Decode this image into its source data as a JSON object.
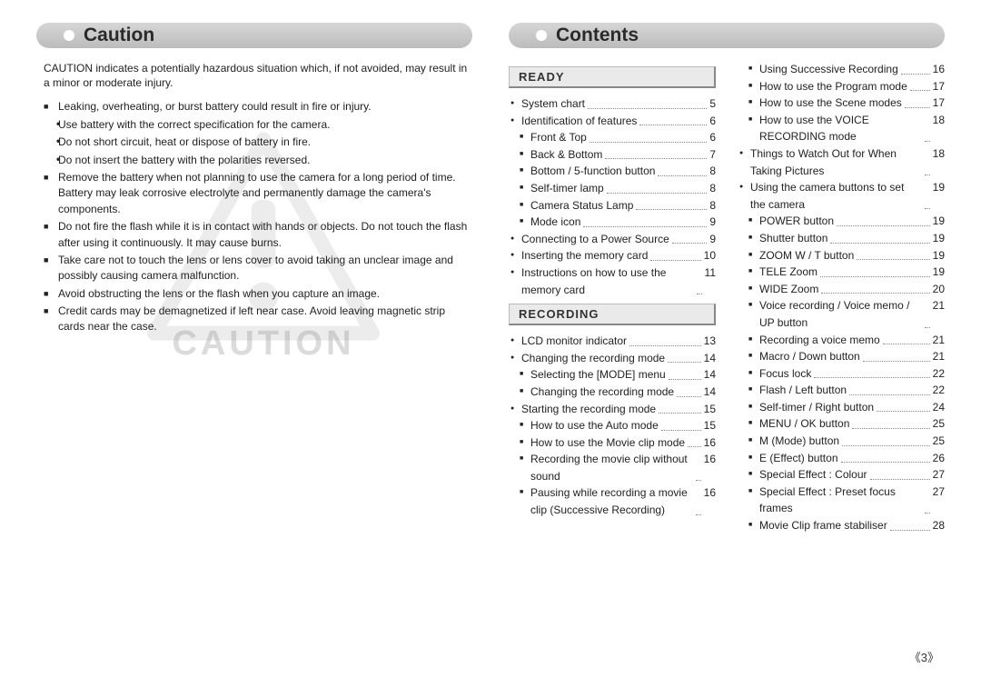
{
  "left": {
    "banner": "Caution",
    "intro": "CAUTION indicates a potentially hazardous situation which, if not avoided, may result in a minor or moderate injury.",
    "watermark": "CAUTION",
    "items": [
      {
        "t": "sq",
        "text": "Leaking, overheating, or burst battery could result in fire or injury."
      },
      {
        "t": "dot",
        "text": "Use battery with the correct specification for the camera."
      },
      {
        "t": "dot",
        "text": "Do not short circuit, heat or dispose of battery in fire."
      },
      {
        "t": "dot",
        "text": "Do not insert the battery with the polarities reversed."
      },
      {
        "t": "sq",
        "text": "Remove the battery when not planning to use the camera for a long period of time. Battery may leak corrosive electrolyte and permanently damage the camera's components."
      },
      {
        "t": "sq",
        "text": "Do not fire the flash while it is in contact with hands or objects. Do not touch the flash after using it continuously. It may cause burns."
      },
      {
        "t": "sq",
        "text": "Take care not to touch the lens or lens cover to avoid taking an unclear image and possibly causing camera malfunction."
      },
      {
        "t": "sq",
        "text": "Avoid obstructing the lens or the flash when you capture an image."
      },
      {
        "t": "sq",
        "text": "Credit cards may be demagnetized if left near case. Avoid leaving magnetic strip cards near the case."
      }
    ]
  },
  "right": {
    "banner": "Contents",
    "sections": [
      {
        "title": "READY",
        "items": [
          {
            "m": "bl",
            "label": "System chart",
            "page": "5"
          },
          {
            "m": "bl",
            "label": "Identification of features",
            "page": "6"
          },
          {
            "m": "sm",
            "ind": true,
            "label": "Front & Top",
            "page": "6"
          },
          {
            "m": "sm",
            "ind": true,
            "label": "Back & Bottom",
            "page": "7"
          },
          {
            "m": "sm",
            "ind": true,
            "label": "Bottom / 5-function button",
            "page": "8"
          },
          {
            "m": "sm",
            "ind": true,
            "label": "Self-timer lamp",
            "page": "8"
          },
          {
            "m": "sm",
            "ind": true,
            "label": "Camera Status Lamp",
            "page": "8"
          },
          {
            "m": "sm",
            "ind": true,
            "label": "Mode icon",
            "page": "9"
          },
          {
            "m": "bl",
            "label": "Connecting to a Power Source",
            "page": "9"
          },
          {
            "m": "bl",
            "label": "Inserting the memory card",
            "page": "10"
          },
          {
            "m": "bl",
            "label": "Instructions on how to use the memory card",
            "page": "11"
          }
        ]
      },
      {
        "title": "RECORDING",
        "items": [
          {
            "m": "bl",
            "label": "LCD monitor indicator",
            "page": "13"
          },
          {
            "m": "bl",
            "label": "Changing the recording mode",
            "page": "14"
          },
          {
            "m": "sm",
            "ind": true,
            "label": "Selecting the [MODE] menu",
            "page": "14"
          },
          {
            "m": "sm",
            "ind": true,
            "label": "Changing the recording mode",
            "page": "14"
          },
          {
            "m": "bl",
            "label": "Starting the recording mode",
            "page": "15"
          },
          {
            "m": "sm",
            "ind": true,
            "label": "How to use the Auto mode",
            "page": "15"
          },
          {
            "m": "sm",
            "ind": true,
            "label": "How to use the Movie clip mode",
            "page": "16"
          },
          {
            "m": "sm",
            "ind": true,
            "label": "Recording the movie clip without sound",
            "page": "16"
          },
          {
            "m": "sm",
            "ind": true,
            "label": "Pausing while recording a movie clip (Successive Recording)",
            "page": "16"
          }
        ]
      }
    ],
    "rightcol": [
      {
        "m": "sm",
        "ind": true,
        "label": "Using Successive Recording",
        "page": "16"
      },
      {
        "m": "sm",
        "ind": true,
        "label": "How to use the Program mode",
        "page": "17"
      },
      {
        "m": "sm",
        "ind": true,
        "label": "How to use the Scene modes",
        "page": "17"
      },
      {
        "m": "sm",
        "ind": true,
        "label": "How to use the VOICE RECORDING mode",
        "page": "18"
      },
      {
        "m": "bl",
        "label": "Things to Watch Out for When Taking Pictures",
        "page": "18"
      },
      {
        "m": "bl",
        "label": "Using the camera buttons to set the camera",
        "page": "19"
      },
      {
        "m": "sm",
        "ind": true,
        "label": "POWER button",
        "page": "19"
      },
      {
        "m": "sm",
        "ind": true,
        "label": "Shutter button",
        "page": "19"
      },
      {
        "m": "sm",
        "ind": true,
        "label": "ZOOM W / T button",
        "page": "19"
      },
      {
        "m": "sm",
        "ind": true,
        "label": "TELE Zoom",
        "page": "19"
      },
      {
        "m": "sm",
        "ind": true,
        "label": "WIDE Zoom",
        "page": "20"
      },
      {
        "m": "sm",
        "ind": true,
        "label": "Voice recording / Voice memo / UP button",
        "page": "21"
      },
      {
        "m": "sm",
        "ind": true,
        "label": "Recording a voice memo",
        "page": "21"
      },
      {
        "m": "sm",
        "ind": true,
        "label": "Macro / Down button",
        "page": "21"
      },
      {
        "m": "sm",
        "ind": true,
        "label": "Focus lock",
        "page": "22"
      },
      {
        "m": "sm",
        "ind": true,
        "label": "Flash / Left button",
        "page": "22"
      },
      {
        "m": "sm",
        "ind": true,
        "label": "Self-timer / Right button",
        "page": "24"
      },
      {
        "m": "sm",
        "ind": true,
        "label": "MENU / OK button",
        "page": "25"
      },
      {
        "m": "sm",
        "ind": true,
        "label": "M (Mode) button",
        "page": "25"
      },
      {
        "m": "sm",
        "ind": true,
        "label": "E (Effect) button",
        "page": "26"
      },
      {
        "m": "sm",
        "ind": true,
        "label": "Special Effect : Colour",
        "page": "27"
      },
      {
        "m": "sm",
        "ind": true,
        "label": "Special Effect : Preset focus frames",
        "page": "27"
      },
      {
        "m": "sm",
        "ind": true,
        "label": "Movie Clip frame stabiliser",
        "page": "28"
      }
    ]
  },
  "pageNumber": "《3》"
}
